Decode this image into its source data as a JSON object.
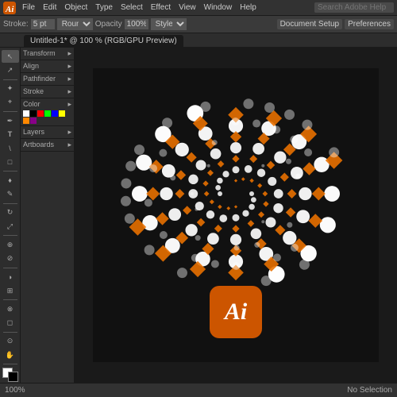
{
  "app": {
    "title": "Adobe Illustrator"
  },
  "menu": {
    "items": [
      "Ai",
      "File",
      "Edit",
      "Object",
      "Type",
      "Select",
      "Effect",
      "View",
      "Window",
      "Help"
    ],
    "search_placeholder": "Search Adobe Help"
  },
  "control_bar": {
    "stroke_label": "Stroke:",
    "stroke_value": "5 pt",
    "stroke_type": "Round",
    "opacity_label": "Opacity",
    "opacity_value": "Style",
    "document_setup": "Document Setup",
    "preferences": "Preferences"
  },
  "tab": {
    "label": "Untitled-1* @ 100 % (RGB/GPU Preview)"
  },
  "status_bar": {
    "zoom": "100%",
    "info": "No Selection"
  },
  "tools": [
    {
      "name": "selection",
      "icon": "↖"
    },
    {
      "name": "direct-selection",
      "icon": "↗"
    },
    {
      "name": "magic-wand",
      "icon": "✦"
    },
    {
      "name": "lasso",
      "icon": "⌖"
    },
    {
      "name": "pen",
      "icon": "✒"
    },
    {
      "name": "type",
      "icon": "T"
    },
    {
      "name": "line",
      "icon": "\\"
    },
    {
      "name": "rectangle",
      "icon": "□"
    },
    {
      "name": "paintbrush",
      "icon": "♦"
    },
    {
      "name": "pencil",
      "icon": "✎"
    },
    {
      "name": "rotate",
      "icon": "↻"
    },
    {
      "name": "scale",
      "icon": "⤢"
    },
    {
      "name": "blend",
      "icon": "⊕"
    },
    {
      "name": "eyedropper",
      "icon": "⊘"
    },
    {
      "name": "gradient",
      "icon": "◑"
    },
    {
      "name": "mesh",
      "icon": "⊞"
    },
    {
      "name": "shapes",
      "icon": "◈"
    },
    {
      "name": "slice",
      "icon": "⊗"
    },
    {
      "name": "eraser",
      "icon": "◻"
    },
    {
      "name": "zoom",
      "icon": "⊙"
    },
    {
      "name": "hand",
      "icon": "✋"
    },
    {
      "name": "fill-stroke",
      "icon": "◧"
    }
  ],
  "canvas": {
    "ai_logo_text": "Ai",
    "background_color": "#111111"
  }
}
